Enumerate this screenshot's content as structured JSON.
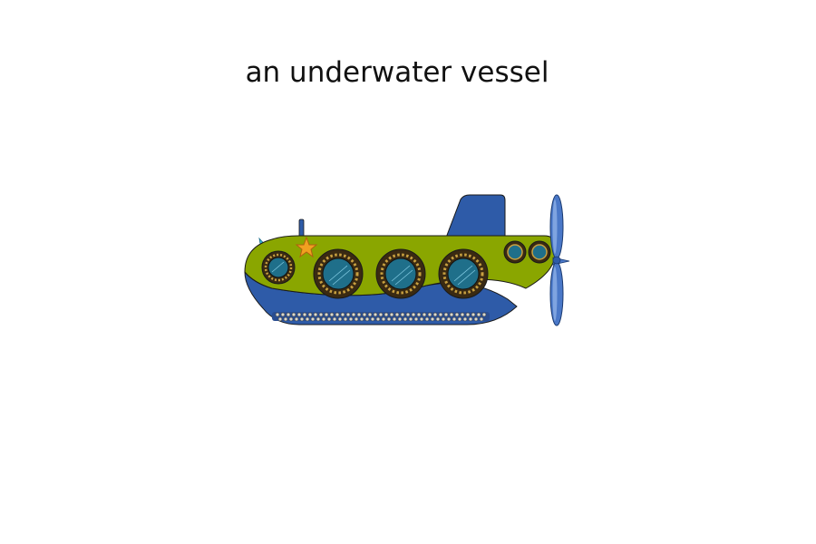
{
  "caption": "an underwater vessel",
  "illustration": {
    "subject": "submarine",
    "colors": {
      "hull_green": "#8aa600",
      "hull_blue": "#2e5ba8",
      "tower_blue": "#2e5ba8",
      "propeller_blue": "#4a78c8",
      "porthole_rim": "#3a2a12",
      "porthole_glass": "#1f6f8a",
      "rivet_gold": "#c8a040",
      "star_orange": "#f0a020",
      "fin_cyan": "#3cc0e0",
      "outline": "#1a1a1a"
    },
    "portholes": 6
  }
}
